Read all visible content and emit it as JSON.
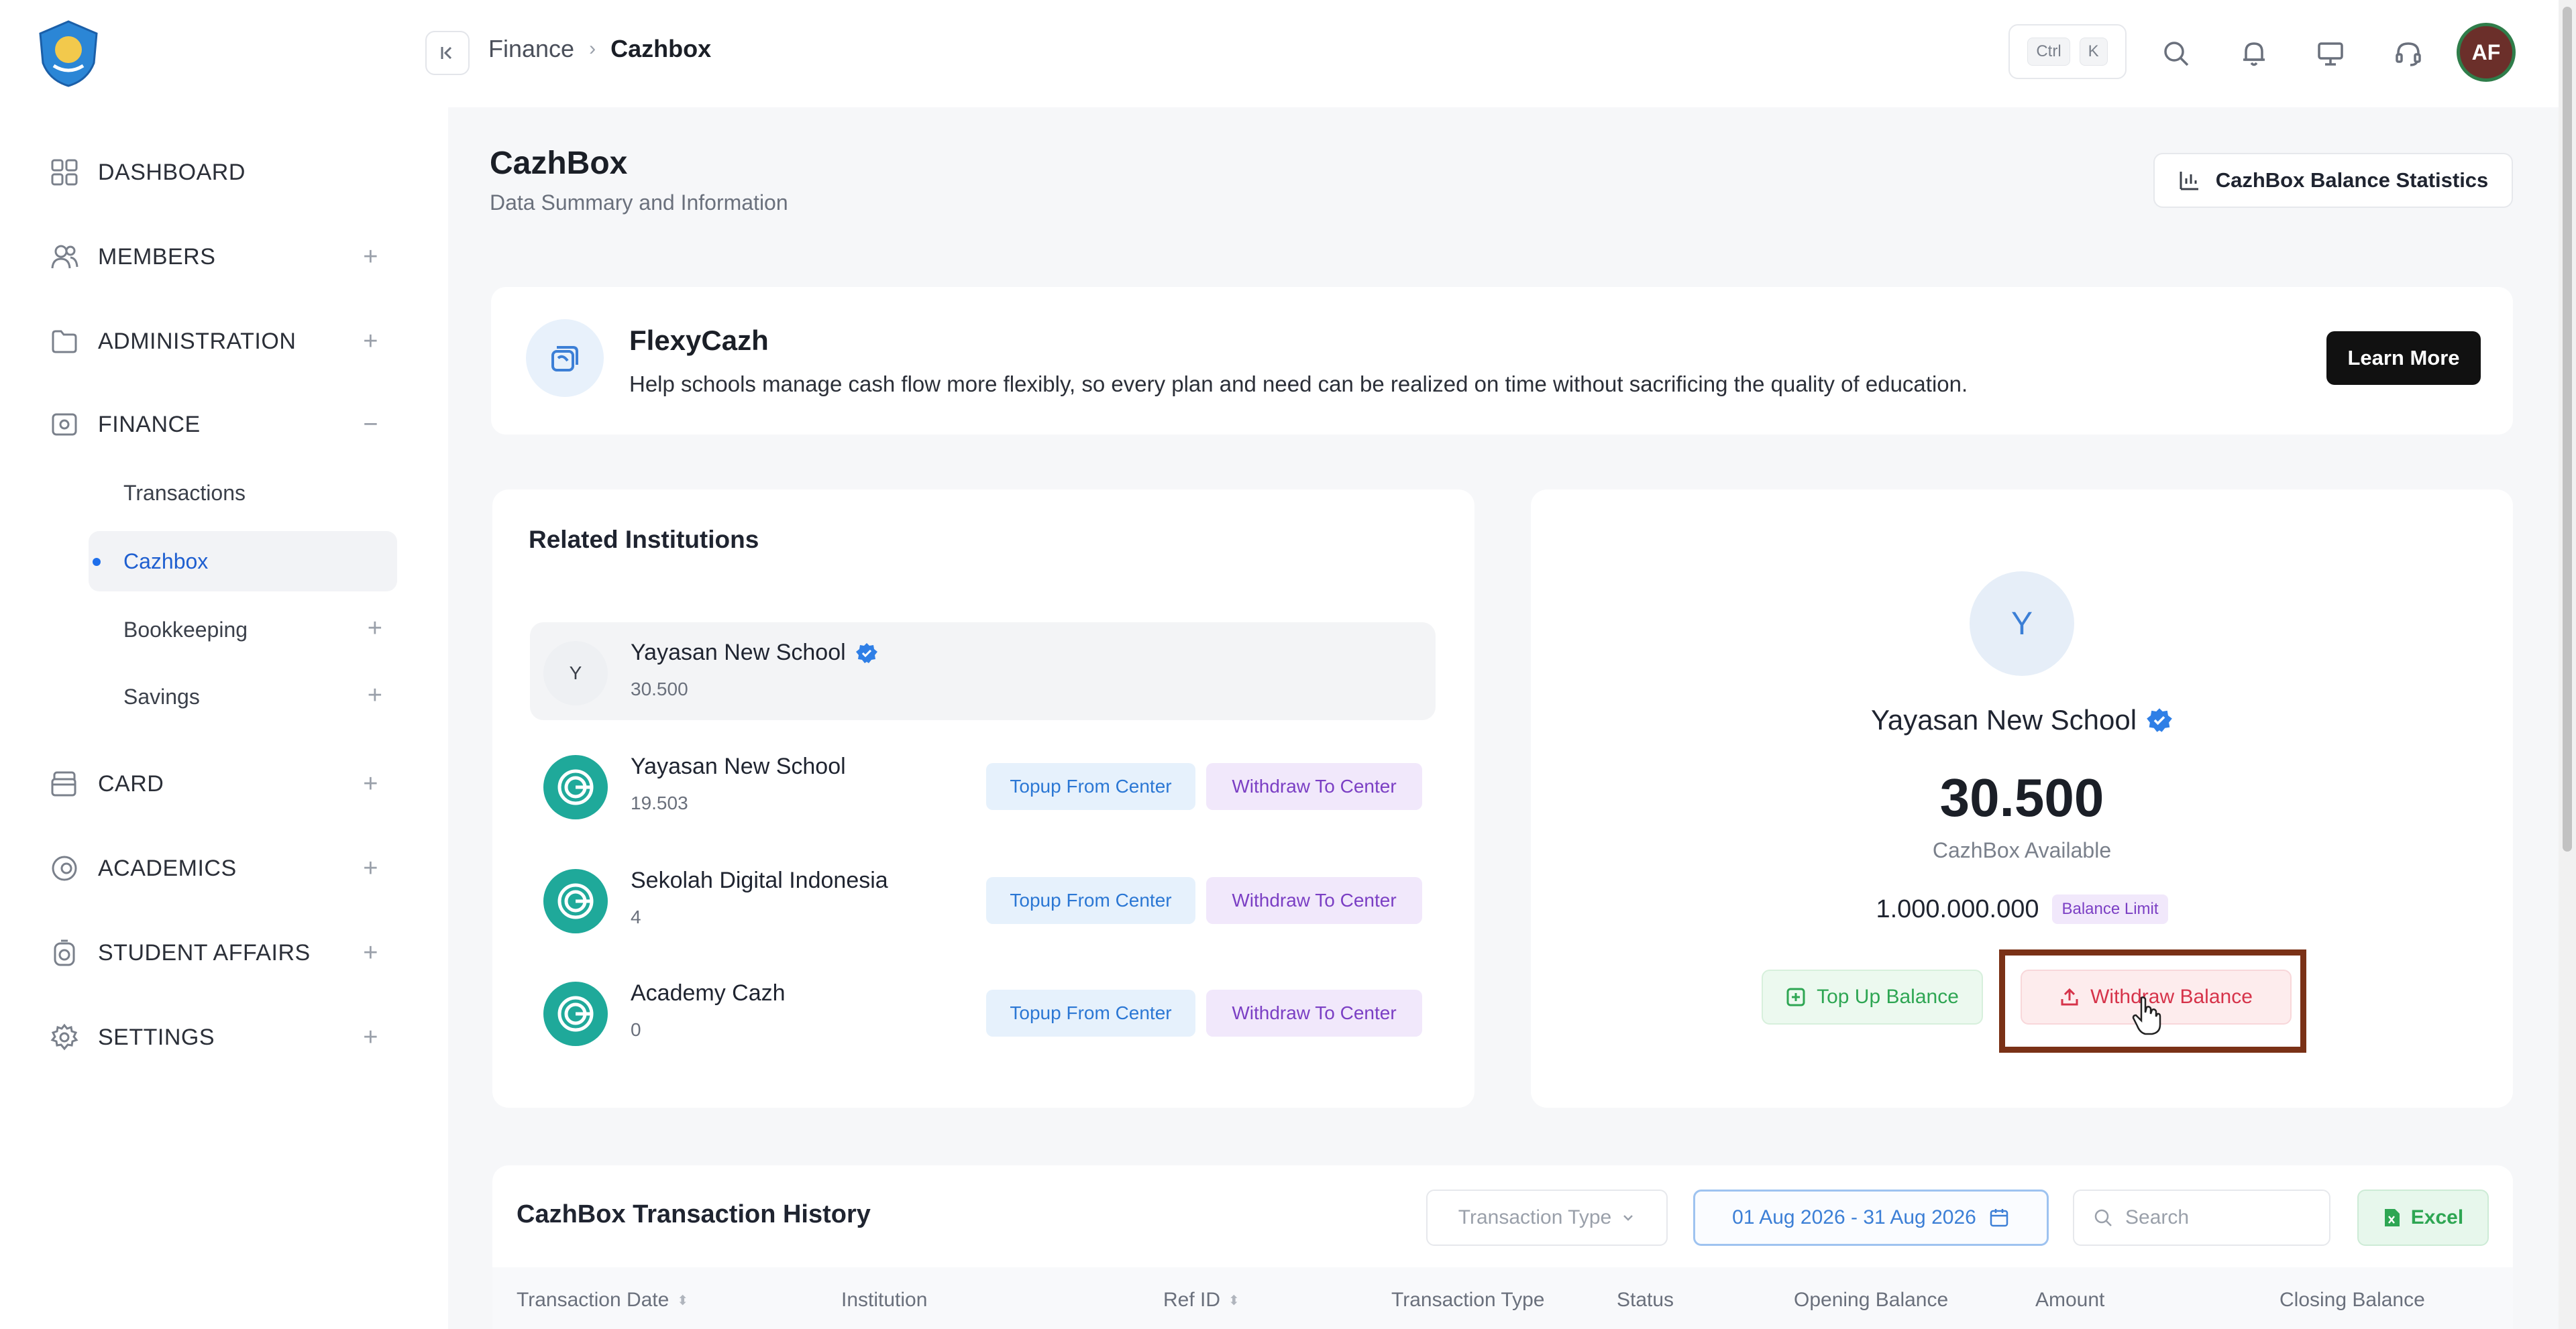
{
  "sidebar": {
    "items": [
      {
        "label": "DASHBOARD",
        "expandable": false
      },
      {
        "label": "MEMBERS",
        "expandable": true
      },
      {
        "label": "ADMINISTRATION",
        "expandable": true
      },
      {
        "label": "FINANCE",
        "expandable": true,
        "expanded": true
      },
      {
        "label": "CARD",
        "expandable": true
      },
      {
        "label": "ACADEMICS",
        "expandable": true
      },
      {
        "label": "STUDENT AFFAIRS",
        "expandable": true
      },
      {
        "label": "SETTINGS",
        "expandable": true
      }
    ],
    "finance_sub": [
      {
        "label": "Transactions"
      },
      {
        "label": "Cazhbox",
        "active": true
      },
      {
        "label": "Bookkeeping"
      },
      {
        "label": "Savings"
      }
    ]
  },
  "topbar": {
    "breadcrumb": [
      "Finance",
      "Cazhbox"
    ],
    "shortcut": [
      "Ctrl",
      "K"
    ],
    "avatar_initials": "AF"
  },
  "page": {
    "title": "CazhBox",
    "subtitle": "Data Summary and Information",
    "stats_button": "CazhBox Balance Statistics"
  },
  "banner": {
    "title": "FlexyCazh",
    "description": "Help schools manage cash flow more flexibly, so every plan and need can be realized on time without sacrificing the quality of education.",
    "cta": "Learn More"
  },
  "related": {
    "title": "Related Institutions",
    "institutions": [
      {
        "initial": "Y",
        "name": "Yayasan New School",
        "balance": "30.500",
        "verified": true
      },
      {
        "name": "Yayasan New School",
        "balance": "19.503"
      },
      {
        "name": "Sekolah Digital Indonesia",
        "balance": "4"
      },
      {
        "name": "Academy Cazh",
        "balance": "0"
      }
    ],
    "topup_label": "Topup From Center",
    "withdraw_label": "Withdraw To Center"
  },
  "balance": {
    "initial": "Y",
    "name": "Yayasan New School",
    "amount": "30.500",
    "amount_label": "CazhBox Available",
    "limit": "1.000.000.000",
    "limit_tag": "Balance Limit",
    "topup_button": "Top Up Balance",
    "withdraw_button": "Withdraw Balance"
  },
  "history": {
    "title": "CazhBox Transaction History",
    "type_placeholder": "Transaction Type",
    "date_range": "01 Aug 2026 - 31 Aug 2026",
    "search_placeholder": "Search",
    "excel_label": "Excel",
    "columns": [
      "Transaction Date",
      "Institution",
      "Ref ID",
      "Transaction Type",
      "Status",
      "Opening Balance",
      "Amount",
      "Closing Balance"
    ]
  },
  "colors": {
    "accent_blue": "#1f6feb",
    "highlight": "#7a3116",
    "danger": "#d6334a",
    "success": "#2ea653"
  }
}
